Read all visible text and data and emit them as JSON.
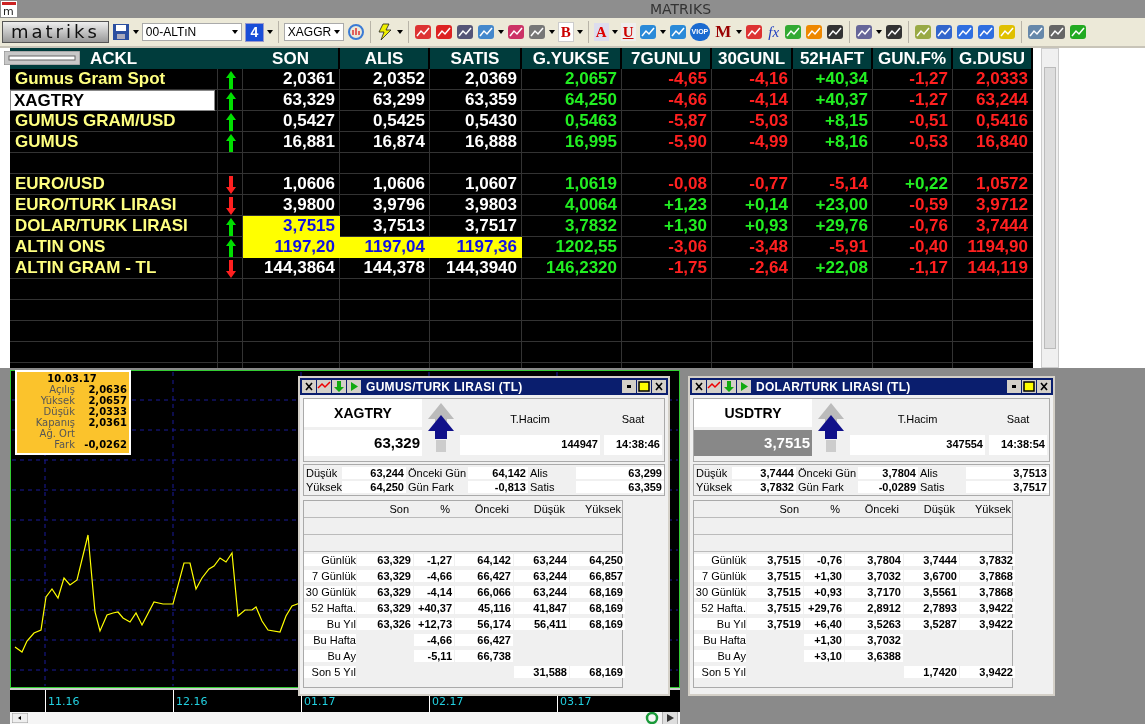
{
  "window": {
    "title": "MATRIKS",
    "icon_letter": "m"
  },
  "toolbar": {
    "logo": "matriks",
    "list_select": "00-ALTıN",
    "page_badge": "4",
    "symbol_select": "XAGGR",
    "letter_buttons": [
      "B",
      "A",
      "U",
      "VIOP",
      "M",
      "fx"
    ]
  },
  "watchlist": {
    "symbol_input": {
      "value": "XAGTRY"
    },
    "columns": [
      {
        "label": "ACKL",
        "kind": "name"
      },
      {
        "kind": "trend"
      },
      {
        "label": "SON",
        "kind": "price"
      },
      {
        "label": "ALIS",
        "kind": "price"
      },
      {
        "label": "SATIS",
        "kind": "price"
      },
      {
        "label": "G.YUKSE",
        "kind": "high"
      },
      {
        "label": "7GUNLU",
        "kind": "change"
      },
      {
        "label": "30GUNL",
        "kind": "change"
      },
      {
        "label": "52HAFT",
        "kind": "change"
      },
      {
        "label": "GUN.F%",
        "kind": "change"
      },
      {
        "label": "G.DUSU",
        "kind": "low"
      }
    ],
    "groups": [
      [
        {
          "name": "Gumus Gram Spot",
          "up": true,
          "cells": [
            "2,0361",
            "2,0352",
            "2,0369",
            "2,0657",
            "-4,65",
            "-4,16",
            "+40,34",
            "-1,27",
            "2,0333"
          ],
          "flash": [
            false,
            false,
            false
          ]
        },
        {
          "up": true,
          "cells": [
            "63,329",
            "63,299",
            "63,359",
            "64,250",
            "-4,66",
            "-4,14",
            "+40,37",
            "-1,27",
            "63,244"
          ],
          "flash": [
            false,
            false,
            false
          ]
        },
        {
          "name": "GUMUS GRAM/USD",
          "up": true,
          "cells": [
            "0,5427",
            "0,5425",
            "0,5430",
            "0,5463",
            "-5,87",
            "-5,03",
            "+8,15",
            "-0,51",
            "0,5416"
          ],
          "flash": [
            false,
            false,
            false
          ]
        },
        {
          "name": "GUMUS",
          "up": true,
          "cells": [
            "16,881",
            "16,874",
            "16,888",
            "16,995",
            "-5,90",
            "-4,99",
            "+8,16",
            "-0,53",
            "16,840"
          ],
          "flash": [
            false,
            false,
            false
          ]
        }
      ],
      [
        {
          "name": "EURO/USD",
          "up": false,
          "cells": [
            "1,0606",
            "1,0606",
            "1,0607",
            "1,0619",
            "-0,08",
            "-0,77",
            "-5,14",
            "+0,22",
            "1,0572"
          ],
          "flash": [
            false,
            false,
            false
          ]
        },
        {
          "name": "EURO/TURK LIRASI",
          "up": false,
          "cells": [
            "3,9800",
            "3,9796",
            "3,9803",
            "4,0064",
            "+1,23",
            "+0,14",
            "+23,00",
            "-0,59",
            "3,9712"
          ],
          "flash": [
            false,
            false,
            false
          ]
        },
        {
          "name": "DOLAR/TURK LIRASI",
          "up": true,
          "cells": [
            "3,7515",
            "3,7513",
            "3,7517",
            "3,7832",
            "+1,30",
            "+0,93",
            "+29,76",
            "-0,76",
            "3,7444"
          ],
          "flash": [
            true,
            false,
            false
          ]
        },
        {
          "name": "ALTIN ONS",
          "up": true,
          "cells": [
            "1197,20",
            "1197,04",
            "1197,36",
            "1202,55",
            "-3,06",
            "-3,48",
            "-5,91",
            "-0,40",
            "1194,90"
          ],
          "flash": [
            true,
            true,
            true
          ]
        },
        {
          "name": "ALTIN GRAM - TL",
          "up": false,
          "cells": [
            "144,3864",
            "144,378",
            "144,3940",
            "146,2320",
            "-1,75",
            "-2,64",
            "+22,08",
            "-1,17",
            "144,119"
          ],
          "flash": [
            false,
            false,
            false
          ]
        }
      ]
    ]
  },
  "chart_window": {
    "info": {
      "date": "10.03.17",
      "rows": [
        {
          "label": "Açılış",
          "value": "2,0636"
        },
        {
          "label": "Yüksek",
          "value": "2,0657"
        },
        {
          "label": "Düşük",
          "value": "2,0333"
        },
        {
          "label": "Kapanış",
          "value": "2,0361"
        },
        {
          "label": "Ağ. Ort"
        },
        {
          "label": "Fark",
          "value": "-0,0262"
        }
      ]
    },
    "axis_labels": [
      "11.16",
      "12.16",
      "01.17",
      "02.17",
      "03.17"
    ]
  },
  "panels": [
    {
      "title": "GUMUS/TURK LIRASI (TL)",
      "symbol": "XAGTRY",
      "price": "63,329",
      "price_highlighted": false,
      "volume_label": "T.Hacim",
      "volume": "144947",
      "time_label": "Saat",
      "time": "14:38:46",
      "stats": [
        {
          "label": "Düşük",
          "value": "63,244"
        },
        {
          "label": "Önceki Gün",
          "value": "64,142"
        },
        {
          "label": "Alis",
          "value": "63,299"
        },
        {
          "label": "Yüksek",
          "value": "64,250"
        },
        {
          "label": "Gün Fark",
          "value": "-0,813"
        },
        {
          "label": "Satis",
          "value": "63,359"
        }
      ],
      "columns": [
        "Son",
        "%",
        "Önceki",
        "Düşük",
        "Yüksek"
      ],
      "rows": [
        {
          "label": "Günlük",
          "cells": [
            "63,329",
            "-1,27",
            "64,142",
            "63,244",
            "64,250"
          ]
        },
        {
          "label": "7 Günlük",
          "cells": [
            "63,329",
            "-4,66",
            "66,427",
            "63,244",
            "66,857"
          ]
        },
        {
          "label": "30 Günlük",
          "cells": [
            "63,329",
            "-4,14",
            "66,066",
            "63,244",
            "68,169"
          ]
        },
        {
          "label": "52 Hafta.",
          "cells": [
            "63,329",
            "+40,37",
            "45,116",
            "41,847",
            "68,169"
          ]
        },
        {
          "label": "Bu Yıl",
          "cells": [
            "63,326",
            "+12,73",
            "56,174",
            "56,411",
            "68,169"
          ]
        },
        {
          "label": "Bu Hafta",
          "cells": [
            null,
            "-4,66",
            "66,427",
            null,
            null
          ]
        },
        {
          "label": "Bu Ay",
          "cells": [
            null,
            "-5,11",
            "66,738",
            null,
            null
          ]
        },
        {
          "label": "Son 5 Yıl",
          "cells": [
            null,
            null,
            null,
            "31,588",
            "68,169"
          ]
        }
      ]
    },
    {
      "title": "DOLAR/TURK LIRASI (TL)",
      "symbol": "USDTRY",
      "price": "3,7515",
      "price_highlighted": true,
      "volume_label": "T.Hacim",
      "volume": "347554",
      "time_label": "Saat",
      "time": "14:38:54",
      "stats": [
        {
          "label": "Düşük",
          "value": "3,7444"
        },
        {
          "label": "Önceki Gün",
          "value": "3,7804"
        },
        {
          "label": "Alis",
          "value": "3,7513"
        },
        {
          "label": "Yüksek",
          "value": "3,7832"
        },
        {
          "label": "Gün Fark",
          "value": "-0,0289"
        },
        {
          "label": "Satis",
          "value": "3,7517"
        }
      ],
      "columns": [
        "Son",
        "%",
        "Önceki",
        "Düşük",
        "Yüksek"
      ],
      "rows": [
        {
          "label": "Günlük",
          "cells": [
            "3,7515",
            "-0,76",
            "3,7804",
            "3,7444",
            "3,7832"
          ]
        },
        {
          "label": "7 Günlük",
          "cells": [
            "3,7515",
            "+1,30",
            "3,7032",
            "3,6700",
            "3,7868"
          ]
        },
        {
          "label": "30 Günlük",
          "cells": [
            "3,7515",
            "+0,93",
            "3,7170",
            "3,5561",
            "3,7868"
          ]
        },
        {
          "label": "52 Hafta.",
          "cells": [
            "3,7515",
            "+29,76",
            "2,8912",
            "2,7893",
            "3,9422"
          ]
        },
        {
          "label": "Bu Yıl",
          "cells": [
            "3,7519",
            "+6,40",
            "3,5263",
            "3,5287",
            "3,9422"
          ]
        },
        {
          "label": "Bu Hafta",
          "cells": [
            null,
            "+1,30",
            "3,7032",
            null,
            null
          ]
        },
        {
          "label": "Bu Ay",
          "cells": [
            null,
            "+3,10",
            "3,6388",
            null,
            null
          ]
        },
        {
          "label": "Son 5 Yıl",
          "cells": [
            null,
            null,
            null,
            "1,7420",
            "3,9422"
          ]
        }
      ]
    }
  ]
}
